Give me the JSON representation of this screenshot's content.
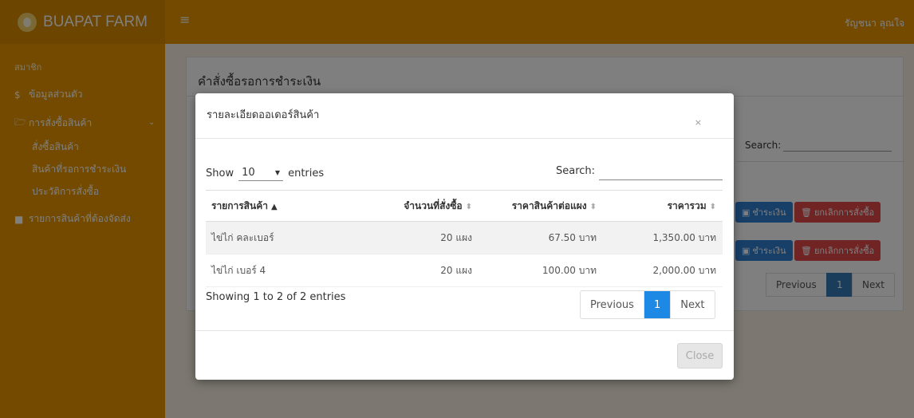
{
  "app": {
    "brand": "BUAPAT FARM",
    "user_name": "รัญชนา ลุณใจ"
  },
  "sidebar": {
    "header": "สมาชิก",
    "items": [
      {
        "label": "ข้อมูลส่วนตัว",
        "icon": "dollar-icon"
      },
      {
        "label": "การสั่งซื้อสินค้า",
        "icon": "folder-open-icon"
      },
      {
        "label": "รายการสินค้าที่ต้องจัดส่ง",
        "icon": "truck-icon"
      }
    ],
    "subitems": [
      "สั่งซื้อสินค้า",
      "สินค้าที่รอการชำระเงิน",
      "ประวัติการสั่งซื้อ"
    ]
  },
  "background_panel": {
    "title": "คำสั่งซื้อรอการชำระเงิน",
    "search_label": "Search:",
    "pay_label": "ชำระเงิน",
    "cancel_label": "ยกเลิกการสั่งซื้อ",
    "prev_label": "Previous",
    "page": "1",
    "next_label": "Next"
  },
  "modal": {
    "title": "รายละเอียดออเดอร์สินค้า",
    "close_x": "×",
    "show_label": "Show",
    "entries_value": "10",
    "entries_label": "entries",
    "search_label": "Search:",
    "columns": [
      "รายการสินค้า",
      "จำนวนที่สั่งซื้อ",
      "ราคาสินค้าต่อแผง",
      "ราคารวม"
    ],
    "rows": [
      [
        "ไข่ไก่ คละเบอร์",
        "20 แผง",
        "67.50 บาท",
        "1,350.00 บาท"
      ],
      [
        "ไข่ไก่ เบอร์ 4",
        "20 แผง",
        "100.00 บาท",
        "2,000.00 บาท"
      ]
    ],
    "info": "Showing 1 to 2 of 2 entries",
    "prev_label": "Previous",
    "page": "1",
    "next_label": "Next",
    "close_button": "Close"
  },
  "colors": {
    "accent": "#e69500",
    "primary": "#1e88e5",
    "danger": "#e04848"
  }
}
